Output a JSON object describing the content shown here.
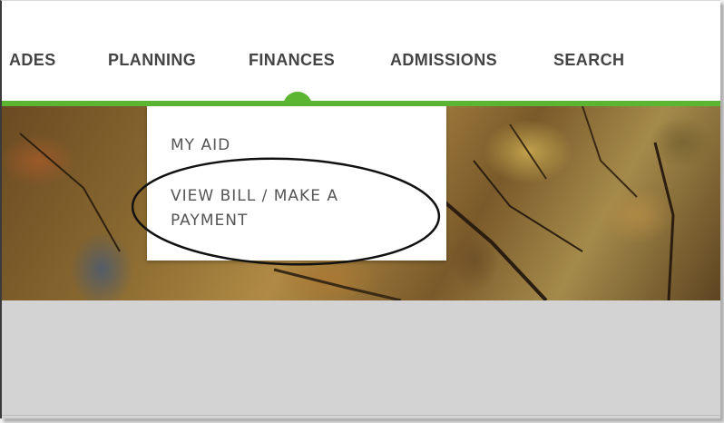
{
  "nav": {
    "items": [
      {
        "label": "ADES"
      },
      {
        "label": "PLANNING"
      },
      {
        "label": "FINANCES"
      },
      {
        "label": "ADMISSIONS"
      },
      {
        "label": "SEARCH"
      }
    ],
    "active": "FINANCES"
  },
  "dropdown": {
    "items": [
      {
        "label": "MY AID"
      },
      {
        "label": "VIEW BILL / MAKE A PAYMENT"
      }
    ]
  },
  "colors": {
    "accent": "#5bb531",
    "nav_text": "#444444",
    "menu_text": "#555555",
    "band": "#d3d3d3"
  }
}
